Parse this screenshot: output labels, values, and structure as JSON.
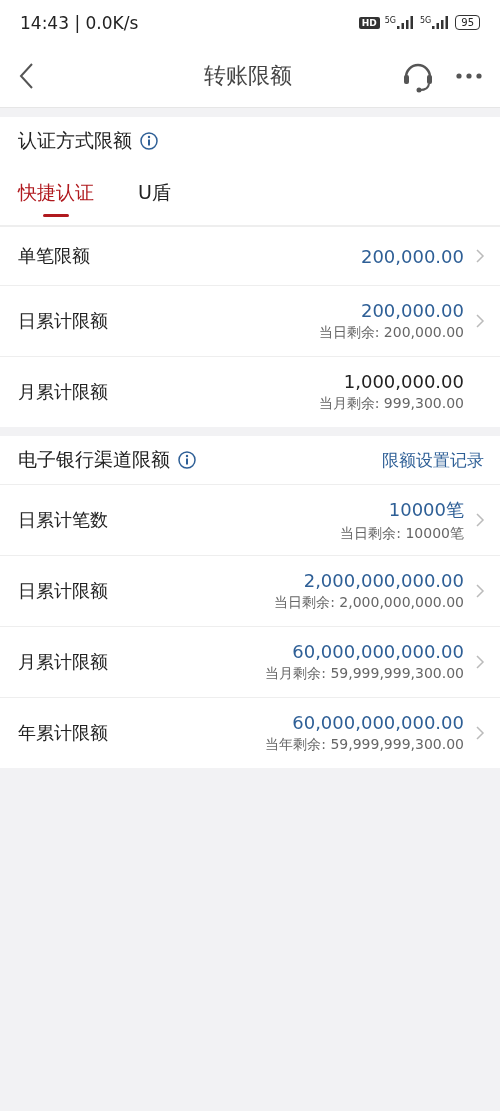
{
  "status_bar": {
    "time": "14:43 | 0.0K/s",
    "hd_badge": "HD",
    "networks": [
      "5G",
      "5G"
    ],
    "battery": "95"
  },
  "nav": {
    "title": "转账限额"
  },
  "sections": [
    {
      "title": "认证方式限额",
      "tabs": [
        {
          "label": "快捷认证",
          "selected": true
        },
        {
          "label": "U盾",
          "selected": false
        }
      ],
      "rows": [
        {
          "label": "单笔限额",
          "value": "200,000.00",
          "editable": true
        },
        {
          "label": "日累计限额",
          "value": "200,000.00",
          "remaining": "当日剩余: 200,000.00",
          "editable": true
        },
        {
          "label": "月累计限额",
          "value": "1,000,000.00",
          "remaining": "当月剩余: 999,300.00",
          "editable": false
        }
      ]
    },
    {
      "title": "电子银行渠道限额",
      "link": "限额设置记录",
      "rows": [
        {
          "label": "日累计笔数",
          "value": "10000笔",
          "remaining": "当日剩余: 10000笔",
          "editable": true
        },
        {
          "label": "日累计限额",
          "value": "2,000,000,000.00",
          "remaining": "当日剩余: 2,000,000,000.00",
          "editable": true
        },
        {
          "label": "月累计限额",
          "value": "60,000,000,000.00",
          "remaining": "当月剩余: 59,999,999,300.00",
          "editable": true
        },
        {
          "label": "年累计限额",
          "value": "60,000,000,000.00",
          "remaining": "当年剩余: 59,999,999,300.00",
          "editable": true
        }
      ]
    }
  ]
}
